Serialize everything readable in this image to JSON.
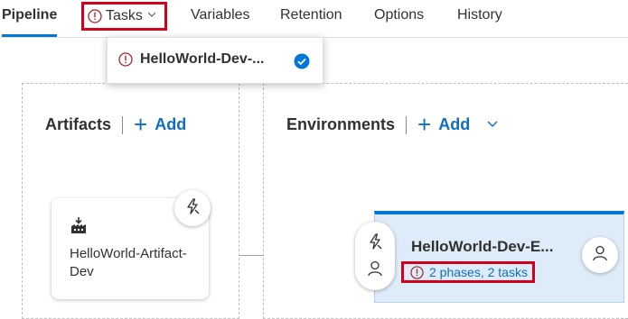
{
  "tabs": {
    "pipeline": "Pipeline",
    "tasks": "Tasks",
    "variables": "Variables",
    "retention": "Retention",
    "options": "Options",
    "history": "History"
  },
  "tasks_dropdown": {
    "items": [
      {
        "label": "HelloWorld-Dev-...",
        "status_icon": "warning-icon",
        "selected_icon": "check-circle-icon"
      }
    ]
  },
  "artifacts": {
    "title": "Artifacts",
    "add_label": "Add",
    "card": {
      "icon": "build-artifact-icon",
      "name": "HelloWorld-Artifact-Dev",
      "trigger_icon": "lightning-icon"
    }
  },
  "environments": {
    "title": "Environments",
    "add_label": "Add",
    "card": {
      "name": "HelloWorld-Dev-E...",
      "tasks_summary": "2 phases, 2 tasks",
      "pre_icons": [
        "lightning-icon",
        "user-icon"
      ],
      "post_icon": "user-icon"
    }
  },
  "colors": {
    "accent": "#0078d4",
    "link": "#106ebe",
    "highlight_border": "#d0021b",
    "warning": "#a4262c",
    "env_card_bg": "#deecf9"
  }
}
